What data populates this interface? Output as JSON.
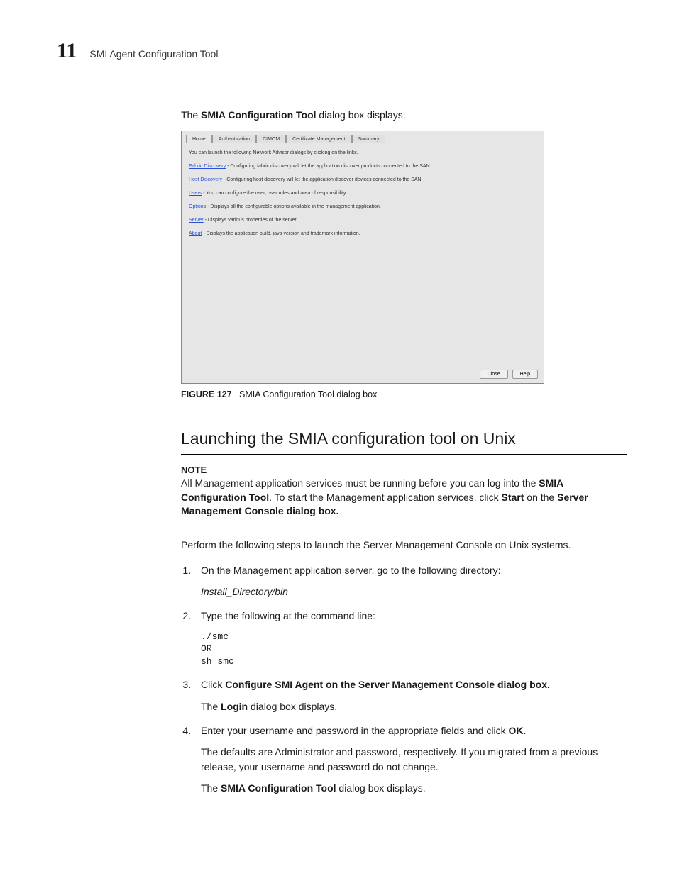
{
  "header": {
    "chapter_num": "11",
    "title": "SMI Agent Configuration Tool"
  },
  "intro": {
    "prefix": "The ",
    "bold": "SMIA Configuration Tool",
    "suffix": " dialog box displays."
  },
  "dialog": {
    "tabs": [
      "Home",
      "Authentication",
      "CIMOM",
      "Certificate Management",
      "Summary"
    ],
    "lead": "You can launch the following Network Advisor dialogs by clicking on the links.",
    "rows": [
      {
        "link": "Fabric Discovery",
        "text": " - Configuring fabric discovery will let the application discover products connected to the SAN."
      },
      {
        "link": "Host Discovery",
        "text": " - Configuring host discovery will let the application discover devices connected to the SAN."
      },
      {
        "link": "Users",
        "text": " - You can configure the user, user roles and area of responsibility."
      },
      {
        "link": "Options",
        "text": " - Displays all the configurable options available in the management application."
      },
      {
        "link": "Server",
        "text": " - Displays various properties of the server."
      },
      {
        "link": "About",
        "text": " - Displays the application build, java version and trademark information."
      }
    ],
    "buttons": {
      "close": "Close",
      "help": "Help"
    }
  },
  "figure": {
    "label": "FIGURE 127",
    "caption": "SMIA Configuration Tool dialog box"
  },
  "section": {
    "heading": "Launching the SMIA configuration tool on Unix"
  },
  "note": {
    "label": "NOTE",
    "s1": "All Management application services must be running before you can log into the ",
    "b1": "SMIA Configuration Tool",
    "s2": ". To start the Management application services, click ",
    "b2": "Start",
    "s3": " on the ",
    "b3": "Server Management Console dialog box."
  },
  "lead": "Perform the following steps to launch the Server Management Console on Unix systems.",
  "steps": {
    "s1": {
      "text": "On the Management application server, go to the following directory:",
      "path": "Install_Directory/bin"
    },
    "s2": {
      "text": "Type the following at the command line:",
      "c1": "./smc",
      "c2": "OR",
      "c3": "sh smc"
    },
    "s3": {
      "prefix": "Click ",
      "bold": "Configure SMI Agent on the Server Management Console dialog box.",
      "sub_a": "The ",
      "sub_b": "Login",
      "sub_c": " dialog box displays."
    },
    "s4": {
      "t1": "Enter your username and password in the appropriate fields and click ",
      "b1": "OK",
      "t2": ".",
      "p2": "The defaults are Administrator and password, respectively. If you migrated from a previous release, your username and password do not change.",
      "p3a": "The ",
      "p3b": "SMIA Configuration Tool",
      "p3c": " dialog box displays."
    }
  }
}
